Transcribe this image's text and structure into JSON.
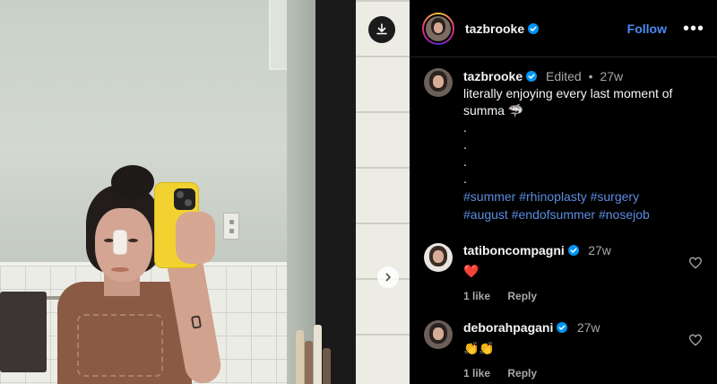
{
  "post": {
    "author": "tazbrooke",
    "follow_label": "Follow",
    "more_label": "•••",
    "caption": {
      "author": "tazbrooke",
      "edited_label": "Edited",
      "separator": "•",
      "time": "27w",
      "text": "literally enjoying every last moment of summa 🦈",
      "dots": [
        ".",
        ".",
        ".",
        "."
      ],
      "hashtags_line1": "#summer #rhinoplasty #surgery",
      "hashtags_line2": "#august #endofsummer #nosejob"
    }
  },
  "comments": [
    {
      "author": "tatiboncompagni",
      "time": "27w",
      "text": "❤️",
      "likes": "1 like",
      "reply_label": "Reply"
    },
    {
      "author": "deborahpagani",
      "time": "27w",
      "text": "👏👏",
      "likes": "1 like",
      "reply_label": "Reply"
    }
  ],
  "colors": {
    "link_blue": "#4a8bf2",
    "hashtag_blue": "#5b8de0",
    "verified_blue": "#0095f6",
    "heart_red": "#ed4956",
    "muted_text": "#a8a8a8"
  },
  "icons": {
    "download": "download-icon",
    "next": "chevron-right-icon",
    "verified": "verified-badge-icon",
    "like": "heart-outline-icon",
    "more": "more-horizontal-icon"
  }
}
